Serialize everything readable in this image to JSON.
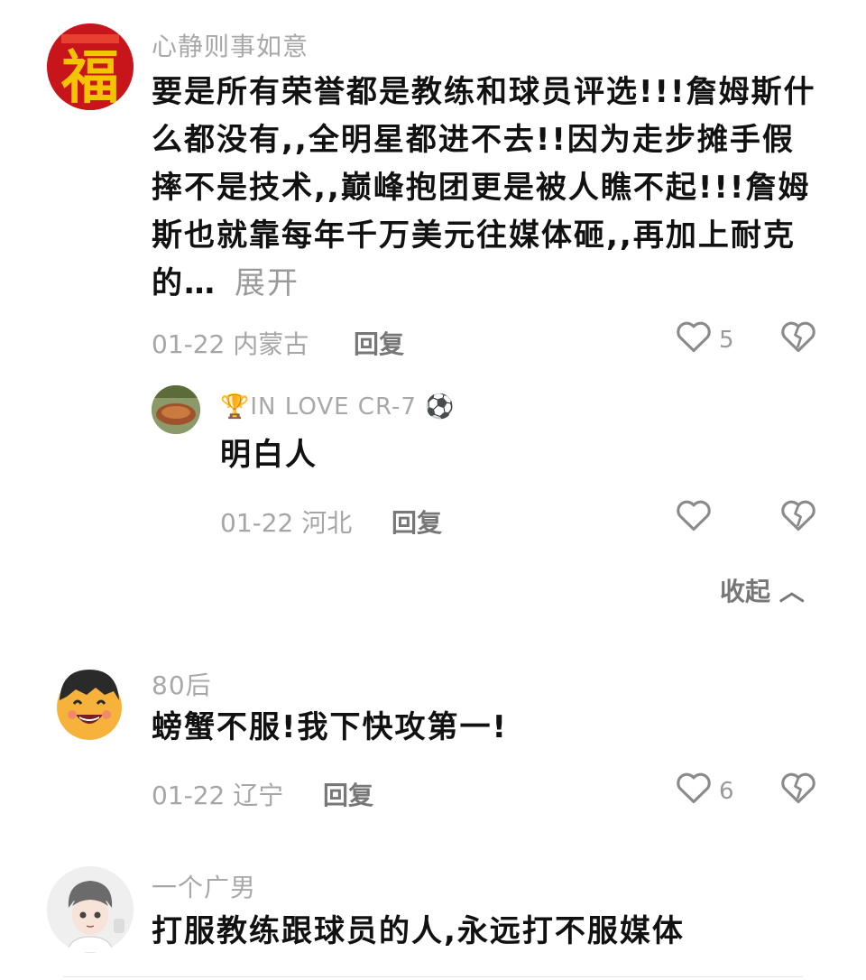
{
  "comments": [
    {
      "username": "心静则事如意",
      "content": "要是所有荣誉都是教练和球员评选!!!詹姆斯什么都没有,,全明星都进不去!!因为走步摊手假摔不是技术,,巅峰抱团更是被人瞧不起!!!詹姆斯也就靠每年千万美元往媒体砸,,再加上耐克的…",
      "expand_label": "展开",
      "date_location": "01-22 内蒙古",
      "reply_label": "回复",
      "like_count": "5",
      "avatar_text": "福"
    },
    {
      "username": "🏆IN LOVE CR-7 ⚽",
      "content": "明白人",
      "date_location": "01-22 河北",
      "reply_label": "回复",
      "like_count": ""
    },
    {
      "username": "80后",
      "content": "螃蟹不服!我下快攻第一!",
      "date_location": "01-22 辽宁",
      "reply_label": "回复",
      "like_count": "6"
    },
    {
      "username": "一个广男",
      "content": "打服教练跟球员的人,永远打不服媒体"
    }
  ],
  "collapse_label": "收起 ︿",
  "colors": {
    "heart": "#8a8a8a",
    "meta": "#a6a6a6",
    "avatar_red": "#d0161d",
    "avatar_gold": "#f5c400"
  },
  "icons": [
    "heart-outline-icon",
    "broken-heart-icon",
    "chevron-up-icon"
  ]
}
